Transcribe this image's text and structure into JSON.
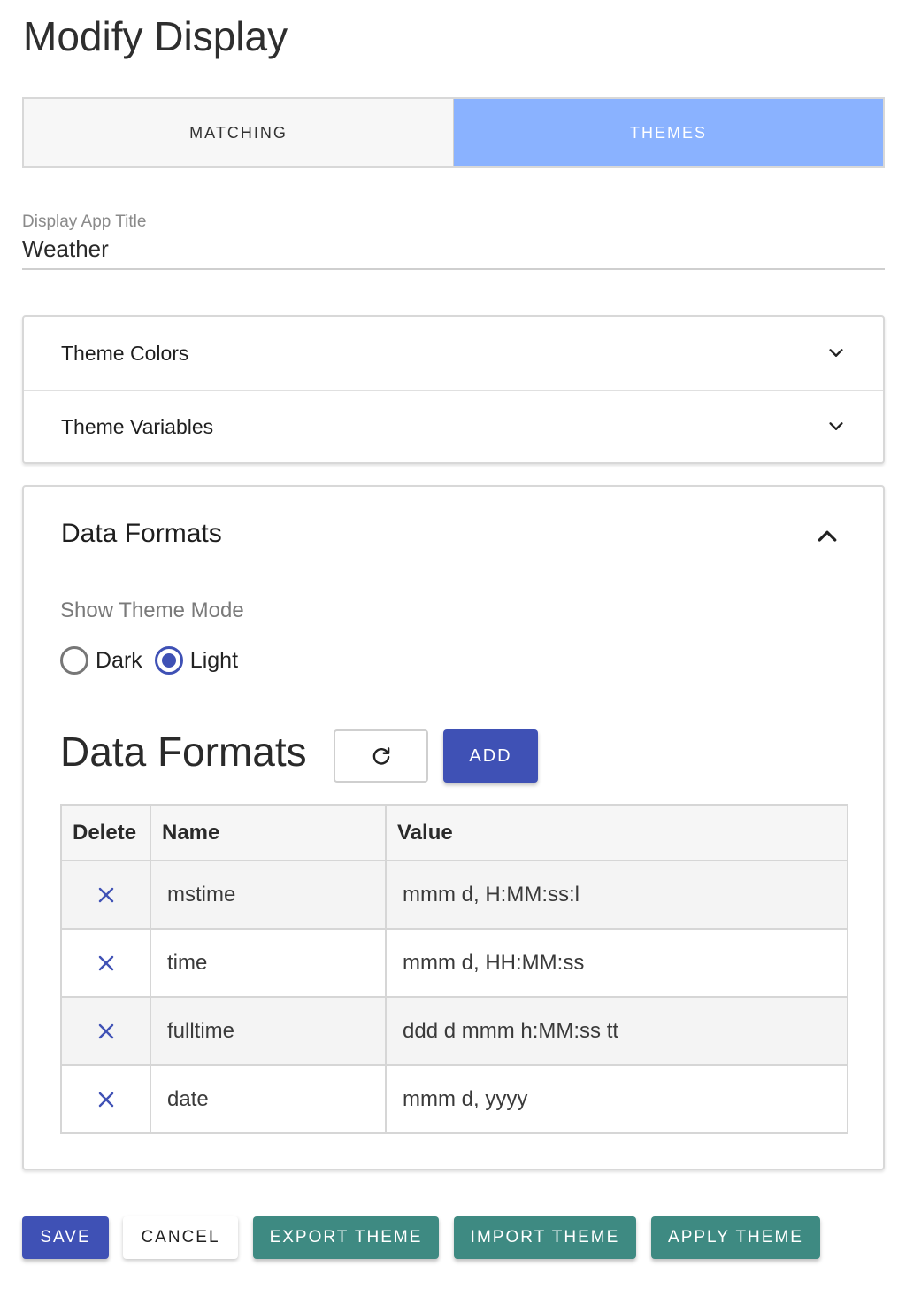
{
  "page": {
    "title": "Modify Display"
  },
  "tabs": [
    {
      "label": "MATCHING",
      "active": false
    },
    {
      "label": "THEMES",
      "active": true
    }
  ],
  "title_field": {
    "label": "Display App Title",
    "value": "Weather"
  },
  "accordion": {
    "theme_colors": "Theme Colors",
    "theme_variables": "Theme Variables"
  },
  "data_formats_panel": {
    "header": "Data Formats",
    "mode_label": "Show Theme Mode",
    "modes": [
      {
        "label": "Dark",
        "checked": false
      },
      {
        "label": "Light",
        "checked": true
      }
    ],
    "section_title": "Data Formats",
    "add_label": "ADD",
    "columns": [
      "Delete",
      "Name",
      "Value"
    ],
    "rows": [
      {
        "name": "mstime",
        "value": "mmm d, H:MM:ss:l"
      },
      {
        "name": "time",
        "value": "mmm d, HH:MM:ss"
      },
      {
        "name": "fulltime",
        "value": "ddd d mmm h:MM:ss tt"
      },
      {
        "name": "date",
        "value": "mmm d, yyyy"
      }
    ]
  },
  "actions": {
    "save": "SAVE",
    "cancel": "CANCEL",
    "export": "EXPORT THEME",
    "import": "IMPORT THEME",
    "apply": "APPLY THEME"
  },
  "colors": {
    "primary": "#3f51b5",
    "active_tab": "#8ab2ff",
    "teal": "#3e8a82"
  },
  "icons": {
    "chevron_down": "chevron-down-icon",
    "chevron_up": "chevron-up-icon",
    "refresh": "refresh-icon",
    "delete": "close-icon"
  }
}
